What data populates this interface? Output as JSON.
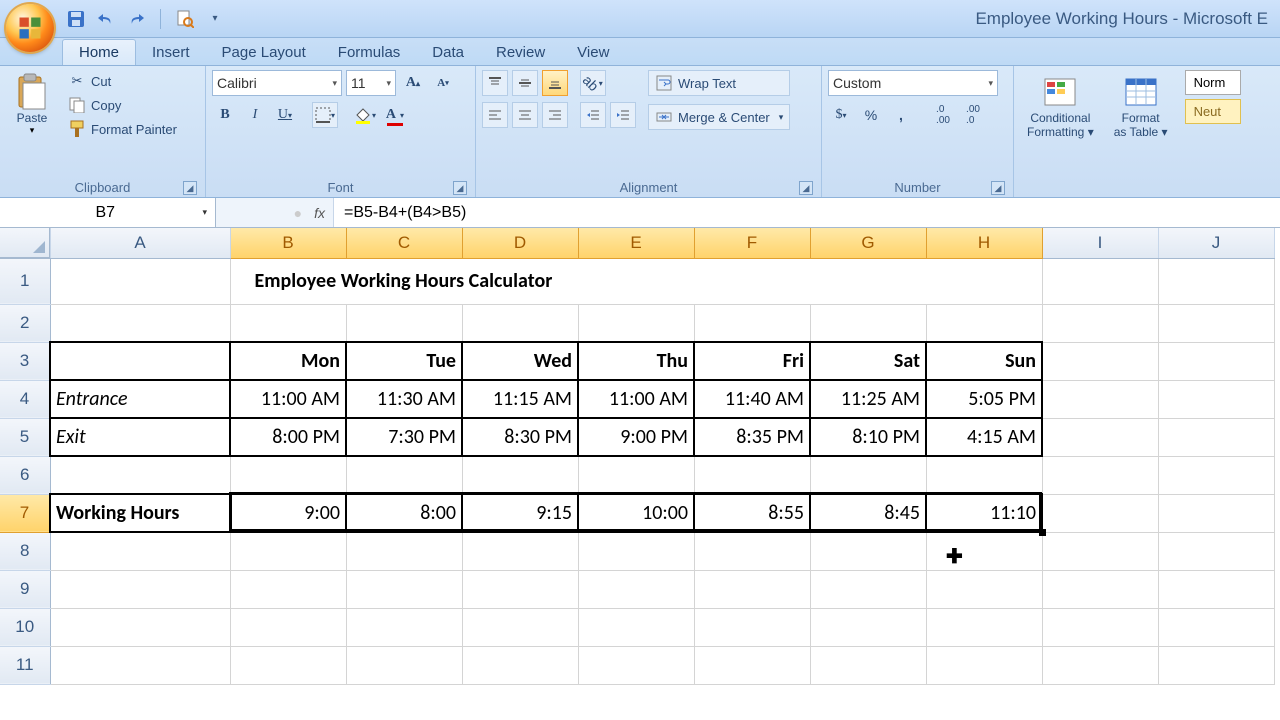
{
  "app_title": "Employee Working Hours - Microsoft E",
  "tabs": [
    "Home",
    "Insert",
    "Page Layout",
    "Formulas",
    "Data",
    "Review",
    "View"
  ],
  "active_tab": 0,
  "clipboard": {
    "paste": "Paste",
    "cut": "Cut",
    "copy": "Copy",
    "painter": "Format Painter",
    "label": "Clipboard"
  },
  "font": {
    "name": "Calibri",
    "size": "11",
    "label": "Font"
  },
  "alignment": {
    "wrap": "Wrap Text",
    "merge": "Merge & Center",
    "label": "Alignment"
  },
  "number": {
    "format": "Custom",
    "label": "Number"
  },
  "styles": {
    "cond": "Conditional",
    "cond2": "Formatting",
    "tbl": "Format",
    "tbl2": "as Table",
    "normal": "Norm",
    "neutral": "Neut"
  },
  "namebox": "B7",
  "formula": "=B5-B4+(B4>B5)",
  "columns": [
    "A",
    "B",
    "C",
    "D",
    "E",
    "F",
    "G",
    "H",
    "I",
    "J"
  ],
  "sel_cols": [
    "B",
    "C",
    "D",
    "E",
    "F",
    "G",
    "H"
  ],
  "rows": [
    "1",
    "2",
    "3",
    "4",
    "5",
    "6",
    "7",
    "8",
    "9",
    "10",
    "11"
  ],
  "sel_rows": [
    "7"
  ],
  "worksheet": {
    "title": "Employee Working Hours Calculator",
    "days": [
      "Mon",
      "Tue",
      "Wed",
      "Thu",
      "Fri",
      "Sat",
      "Sun"
    ],
    "entrance_label": "Entrance",
    "entrance": [
      "11:00 AM",
      "11:30 AM",
      "11:15 AM",
      "11:00 AM",
      "11:40 AM",
      "11:25 AM",
      "5:05 PM"
    ],
    "exit_label": "Exit",
    "exit": [
      "8:00 PM",
      "7:30 PM",
      "8:30 PM",
      "9:00 PM",
      "8:35 PM",
      "8:10 PM",
      "4:15 AM"
    ],
    "working_label": "Working Hours",
    "working": [
      "9:00",
      "8:00",
      "9:15",
      "10:00",
      "8:55",
      "8:45",
      "11:10"
    ]
  }
}
